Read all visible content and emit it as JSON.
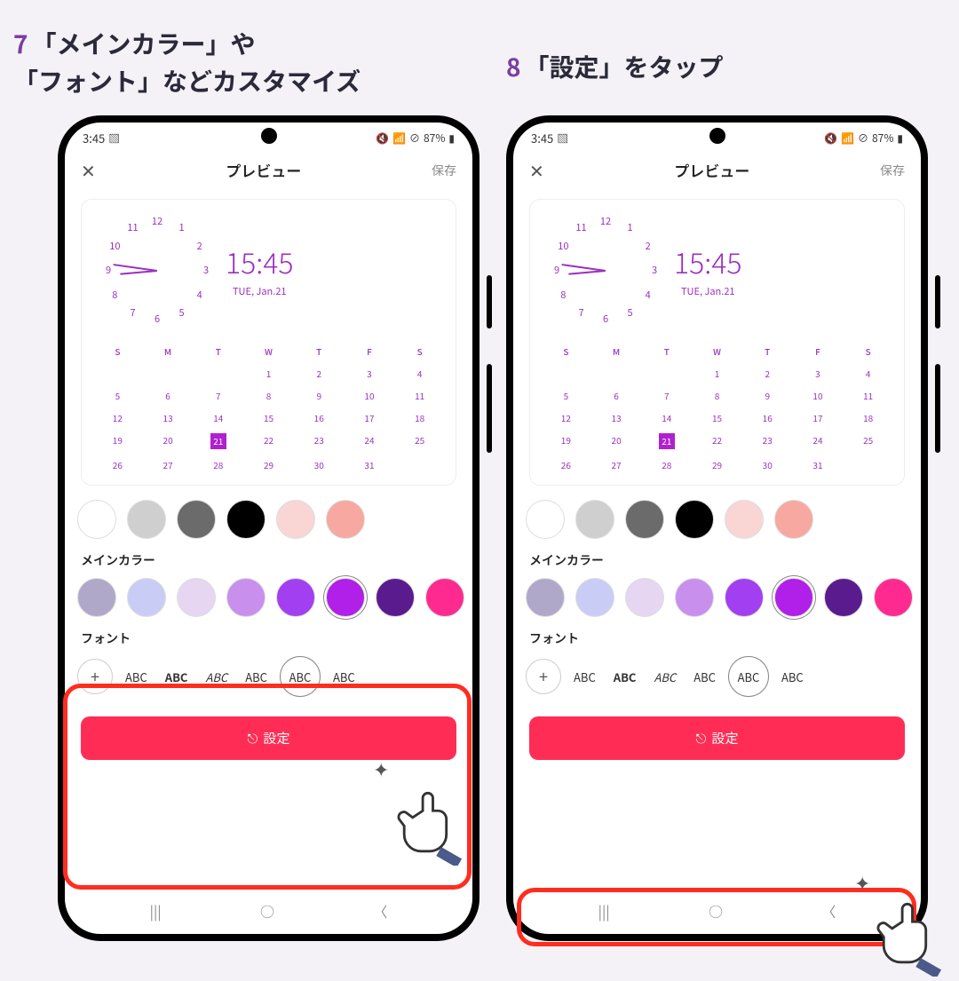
{
  "steps": {
    "s7_num": "7",
    "s7_line1": "「メインカラー」や",
    "s7_line2": "「フォント」などカスタマイズ",
    "s8_num": "8",
    "s8_text": "「設定」をタップ"
  },
  "status": {
    "time": "3:45",
    "battery": "87%"
  },
  "header": {
    "title": "プレビュー",
    "save": "保存"
  },
  "clock": {
    "digital_time": "15:45",
    "date": "TUE, Jan.21"
  },
  "calendar": {
    "days": [
      "S",
      "M",
      "T",
      "W",
      "T",
      "F",
      "S"
    ],
    "weeks": [
      [
        "",
        "",
        "",
        "1",
        "2",
        "3",
        "4"
      ],
      [
        "5",
        "6",
        "7",
        "8",
        "9",
        "10",
        "11"
      ],
      [
        "12",
        "13",
        "14",
        "15",
        "16",
        "17",
        "18"
      ],
      [
        "19",
        "20",
        "21",
        "22",
        "23",
        "24",
        "25"
      ],
      [
        "26",
        "27",
        "28",
        "29",
        "30",
        "31",
        ""
      ]
    ],
    "today": "21"
  },
  "labels": {
    "main_color": "メインカラー",
    "font": "フォント"
  },
  "bg_colors": [
    "#ffffff",
    "#cfcfcf",
    "#6b6b6b",
    "#000000",
    "#f9d5d3",
    "#f7a8a0"
  ],
  "main_colors": [
    "#b0a8c9",
    "#c9cdf5",
    "#e6d6f2",
    "#c98fed",
    "#a23ff0",
    "#b020e8",
    "#5a1b8f",
    "#ff2a90"
  ],
  "fonts": {
    "add": "+",
    "items": [
      "ABC",
      "ABC",
      "ABC",
      "ABC",
      "ABC",
      "ABC"
    ],
    "selected_index": 4
  },
  "button": {
    "set": "設定"
  },
  "analog_numbers": [
    "12",
    "1",
    "2",
    "3",
    "4",
    "5",
    "6",
    "7",
    "8",
    "9",
    "10",
    "11"
  ]
}
